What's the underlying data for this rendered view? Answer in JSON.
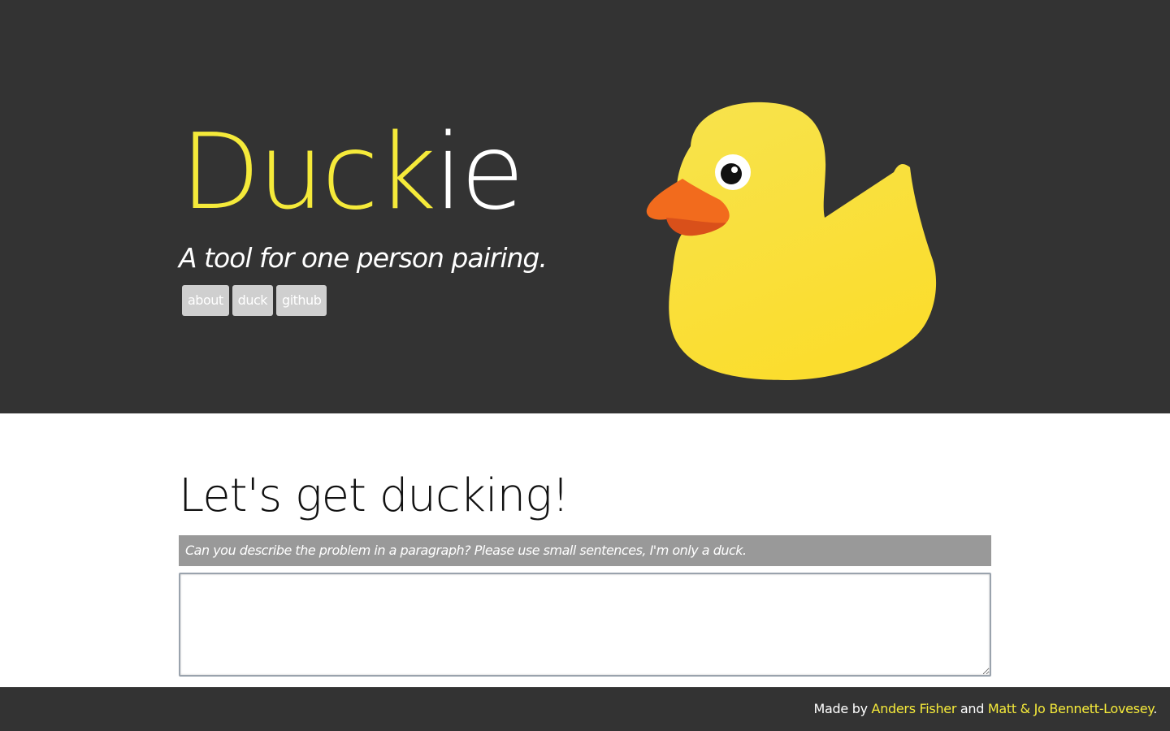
{
  "header": {
    "brand_part1": "Duck",
    "brand_part2": "ie",
    "tagline": "A tool for one person pairing.",
    "nav": [
      "about",
      "duck",
      "github"
    ]
  },
  "main": {
    "title": "Let's get ducking!",
    "prompt": "Can you describe the problem in a paragraph? Please use small sentences, I'm only a duck.",
    "answer_value": ""
  },
  "footer": {
    "made_by": "Made by",
    "author1": "Anders Fisher",
    "and": "and",
    "author2": "Matt & Jo Bennett-Lovesey",
    "period": "."
  },
  "colors": {
    "hero_bg": "#333333",
    "accent_yellow": "#f5ea3a",
    "duck_beak": "#f26b1d",
    "nav_button": "#cfcfcf",
    "prompt_bg": "#999999"
  },
  "icons": {
    "hero_image": "rubber-duck-illustration"
  }
}
